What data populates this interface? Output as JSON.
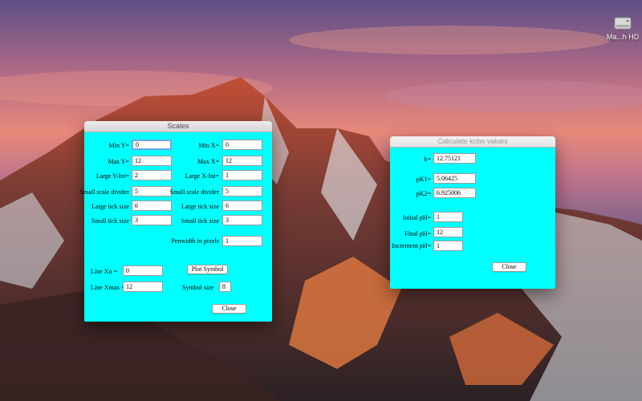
{
  "desktop": {
    "disk_label": "Ma...h HD"
  },
  "scales": {
    "title": "Scales",
    "left": [
      {
        "label": "Min Y=",
        "value": "0"
      },
      {
        "label": "Max Y=",
        "value": "12"
      },
      {
        "label": "Large Y-Int=",
        "value": "2"
      },
      {
        "label": "Small scale divider",
        "value": "5"
      },
      {
        "label": "Large tick size",
        "value": "6"
      },
      {
        "label": "Small tick size",
        "value": "3"
      }
    ],
    "right": [
      {
        "label": "Min X=",
        "value": "0"
      },
      {
        "label": "Max X=",
        "value": "12"
      },
      {
        "label": "Large X-Int=",
        "value": "1"
      },
      {
        "label": "Small scale divider",
        "value": "5"
      },
      {
        "label": "Large tick size",
        "value": "6"
      },
      {
        "label": "Small tick size",
        "value": "3"
      }
    ],
    "penwidth": {
      "label": "Penwidth in pixels",
      "value": "1"
    },
    "line_xo": {
      "label": "Line Xo =",
      "value": "0"
    },
    "line_xmax": {
      "label": "Line Xmax =",
      "value": "12"
    },
    "plot_symbol_label": "Plot Symbol",
    "symbol_size": {
      "label": "Symbol size",
      "value": "8"
    },
    "close_label": "Close"
  },
  "kobs": {
    "title": "Calculate kobs values",
    "k": {
      "label": "k=",
      "value": "12.75121"
    },
    "pk1": {
      "label": "pK1=",
      "value": "5.06425"
    },
    "pk2": {
      "label": "pK2=",
      "value": "6.925006"
    },
    "initial_ph": {
      "label": "Initial pH=",
      "value": "1"
    },
    "final_ph": {
      "label": "Final pH=",
      "value": "12"
    },
    "increment_ph": {
      "label": "Increment pH=",
      "value": "1"
    },
    "close_label": "Close"
  }
}
